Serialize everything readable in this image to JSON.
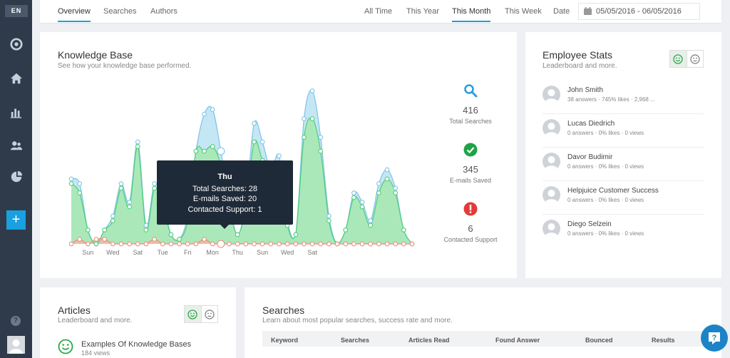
{
  "lang": "EN",
  "tabs": [
    "Overview",
    "Searches",
    "Authors"
  ],
  "ranges": [
    "All Time",
    "This Year",
    "This Month",
    "This Week",
    "Date"
  ],
  "date_range": "05/05/2016 - 06/05/2016",
  "kb": {
    "title": "Knowledge Base",
    "subtitle": "See how your knowledge base performed.",
    "stats": [
      {
        "value": "416",
        "label": "Total Searches"
      },
      {
        "value": "345",
        "label": "E-mails Saved"
      },
      {
        "value": "6",
        "label": "Contacted Support"
      }
    ],
    "tooltip": {
      "title": "Thu",
      "line1": "Total Searches: 28",
      "line2": "E-mails Saved: 20",
      "line3": "Contacted Support: 1"
    }
  },
  "chart_data": {
    "type": "area",
    "x_tick_labels": [
      "Sun",
      "Wed",
      "Sat",
      "Tue",
      "Fri",
      "Mon",
      "Thu",
      "Sun",
      "Wed",
      "Sat"
    ],
    "colors": {
      "searches": "#bfe3f3",
      "saved": "#a9e8b6",
      "support": "#f2b8a8"
    },
    "series": [
      {
        "values": [
          14,
          13,
          3,
          0,
          3,
          6,
          13,
          9,
          22,
          4,
          13,
          9,
          2,
          1,
          6,
          20,
          28,
          29,
          20,
          9,
          2,
          9,
          26,
          22,
          16,
          19,
          5,
          2,
          27,
          33,
          23,
          6,
          0,
          3,
          11,
          9,
          5,
          13,
          16,
          12,
          3,
          0
        ]
      },
      {
        "values": [
          13,
          11,
          3,
          0,
          3,
          5,
          12,
          8,
          21,
          3,
          12,
          8,
          2,
          1,
          5,
          20,
          20,
          21,
          17,
          8,
          2,
          8,
          22,
          18,
          14,
          16,
          4,
          2,
          23,
          27,
          20,
          5,
          0,
          3,
          10,
          8,
          4,
          11,
          14,
          11,
          3,
          0
        ]
      },
      {
        "values": [
          0,
          1,
          0,
          1,
          1,
          0,
          0,
          0,
          0,
          0,
          1,
          0,
          0,
          0,
          0,
          0,
          1,
          0,
          0,
          0,
          0,
          0,
          0,
          0,
          0,
          0,
          0,
          0,
          0,
          0,
          0,
          0,
          0,
          0,
          0,
          0,
          0,
          0,
          0,
          0,
          0,
          0
        ]
      }
    ]
  },
  "employees": {
    "title": "Employee Stats",
    "subtitle": "Leaderboard and more.",
    "rows": [
      {
        "name": "John Smith",
        "meta": "38 answers · 745% likes · 2,968 ..."
      },
      {
        "name": "Lucas Diedrich",
        "meta": "0 answers · 0% likes · 0 views"
      },
      {
        "name": "Davor Budimir",
        "meta": "0 answers · 0% likes · 0 views"
      },
      {
        "name": "Helpjuice Customer Success",
        "meta": "0 answers · 0% likes · 0 views"
      },
      {
        "name": "Diego Selzein",
        "meta": "0 answers · 0% likes · 0 views"
      }
    ]
  },
  "articles": {
    "title": "Articles",
    "subtitle": "Leaderboard and more.",
    "item": {
      "title": "Examples Of Knowledge Bases",
      "meta": "184 views"
    }
  },
  "searches": {
    "title": "Searches",
    "subtitle": "Learn about most popular searches, success rate and more.",
    "columns": [
      "Keyword",
      "Searches",
      "Articles Read",
      "Found Answer",
      "Bounced",
      "Results"
    ]
  }
}
